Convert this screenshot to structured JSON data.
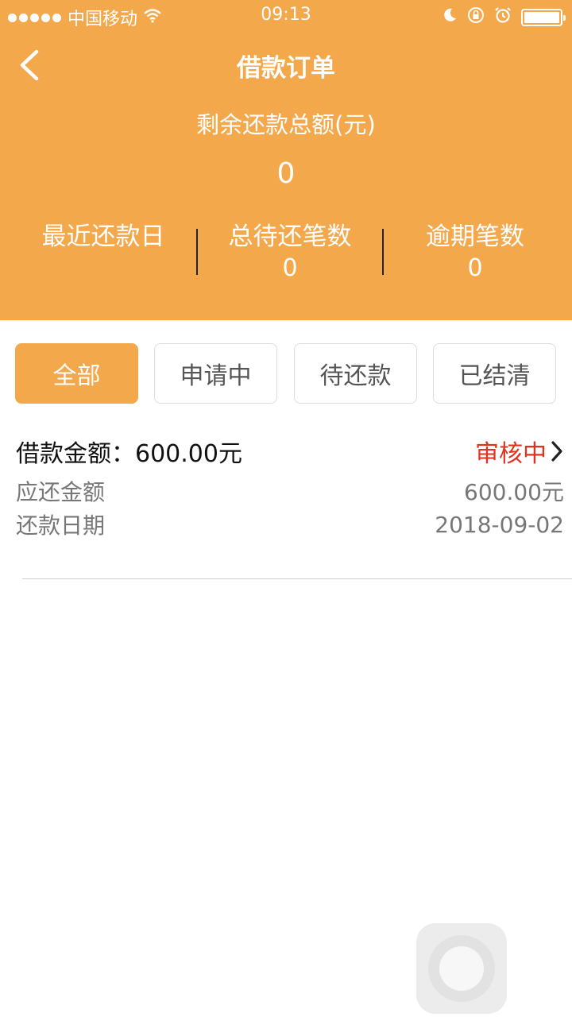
{
  "status_bar": {
    "carrier": "中国移动",
    "time": "09:13"
  },
  "nav": {
    "title": "借款订单"
  },
  "summary": {
    "label": "剩余还款总额(元)",
    "value": "0"
  },
  "stats": [
    {
      "label": "最近还款日",
      "value": ""
    },
    {
      "label": "总待还笔数",
      "value": "0"
    },
    {
      "label": "逾期笔数",
      "value": "0"
    }
  ],
  "tabs": [
    {
      "label": "全部",
      "active": true
    },
    {
      "label": "申请中",
      "active": false
    },
    {
      "label": "待还款",
      "active": false
    },
    {
      "label": "已结清",
      "active": false
    }
  ],
  "orders": [
    {
      "amount_label": "借款金额：",
      "amount_value": "600.00元",
      "status": "审核中",
      "due_label": "应还金额",
      "due_value": "600.00元",
      "date_label": "还款日期",
      "date_value": "2018-09-02"
    }
  ],
  "colors": {
    "brand": "#f4a84c",
    "status_red": "#e0321e"
  }
}
